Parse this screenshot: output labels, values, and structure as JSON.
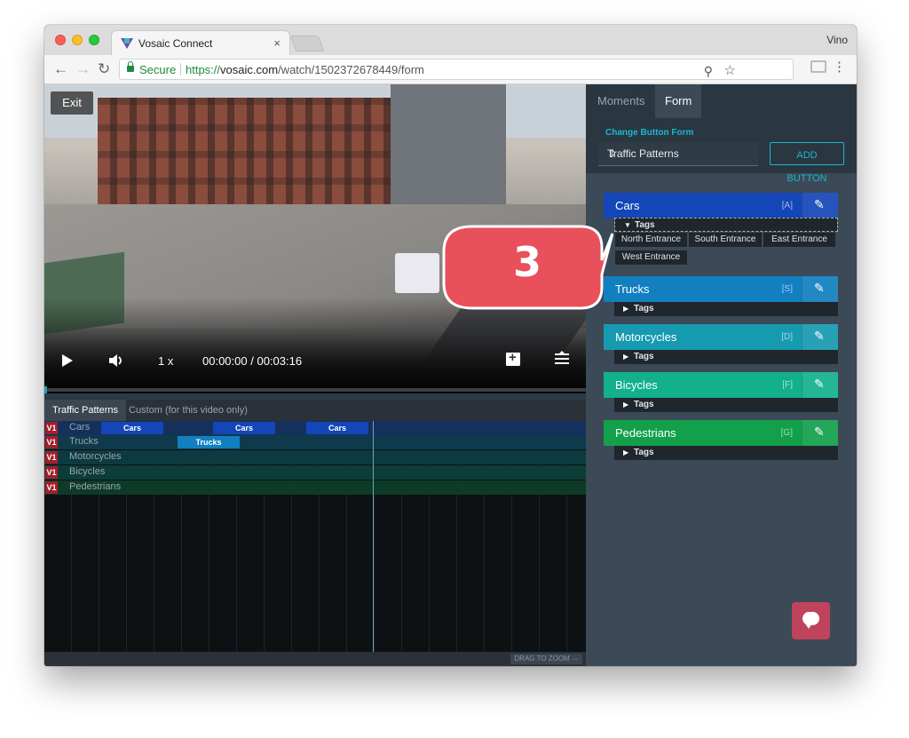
{
  "browser": {
    "tab_title": "Vosaic Connect",
    "tab_close": "×",
    "profile": "Vino",
    "secure_label": "Secure",
    "url_proto": "https://",
    "url_host": "vosaic.com",
    "url_path": "/watch/1502372678449/form",
    "back_glyph": "←",
    "forward_glyph": "→",
    "reload_glyph": "↻",
    "zoom_glyph": "⚲",
    "star_glyph": "☆",
    "menu_glyph": "⋮"
  },
  "video": {
    "exit_label": "Exit",
    "speed": "1 x",
    "current_time": "00:00:00",
    "time_separator": "/",
    "duration": "00:03:16"
  },
  "timeline": {
    "tabs": [
      {
        "label": "Traffic Patterns"
      },
      {
        "label": "Custom (for this video only)"
      }
    ],
    "version_badge": "V1",
    "tracks": [
      {
        "label": "Cars",
        "segments": [
          {
            "label": "Cars"
          },
          {
            "label": "Cars"
          },
          {
            "label": "Cars"
          }
        ]
      },
      {
        "label": "Trucks",
        "segments": [
          {
            "label": "Trucks"
          }
        ]
      },
      {
        "label": "Motorcycles"
      },
      {
        "label": "Bicycles"
      },
      {
        "label": "Pedestrians"
      }
    ],
    "drag_zoom": "DRAG TO ZOOM ⇔"
  },
  "panel": {
    "tabs": [
      {
        "label": "Moments"
      },
      {
        "label": "Form"
      }
    ],
    "change_form_label": "Change Button Form",
    "form_select_value": "Traffic Patterns",
    "form_select_caret": "⇕",
    "add_button_label": "ADD BUTTON",
    "tags_label": "Tags",
    "tag_open_glyph": "▼",
    "tag_closed_glyph": "▶",
    "edit_glyph": "✎",
    "categories": [
      {
        "label": "Cars",
        "key": "[A]",
        "color": "#1446b8"
      },
      {
        "label": "Trucks",
        "key": "[S]",
        "color": "#117fc0"
      },
      {
        "label": "Motorcycles",
        "key": "[D]",
        "color": "#169ab0"
      },
      {
        "label": "Bicycles",
        "key": "[F]",
        "color": "#13b08c"
      },
      {
        "label": "Pedestrians",
        "key": "[G]",
        "color": "#12a04b"
      }
    ],
    "cars_tags": [
      {
        "label": "North Entrance"
      },
      {
        "label": "South Entrance"
      },
      {
        "label": "East Entrance"
      },
      {
        "label": "West Entrance"
      }
    ]
  },
  "callout": {
    "number": "3",
    "color": "#e8505b"
  }
}
